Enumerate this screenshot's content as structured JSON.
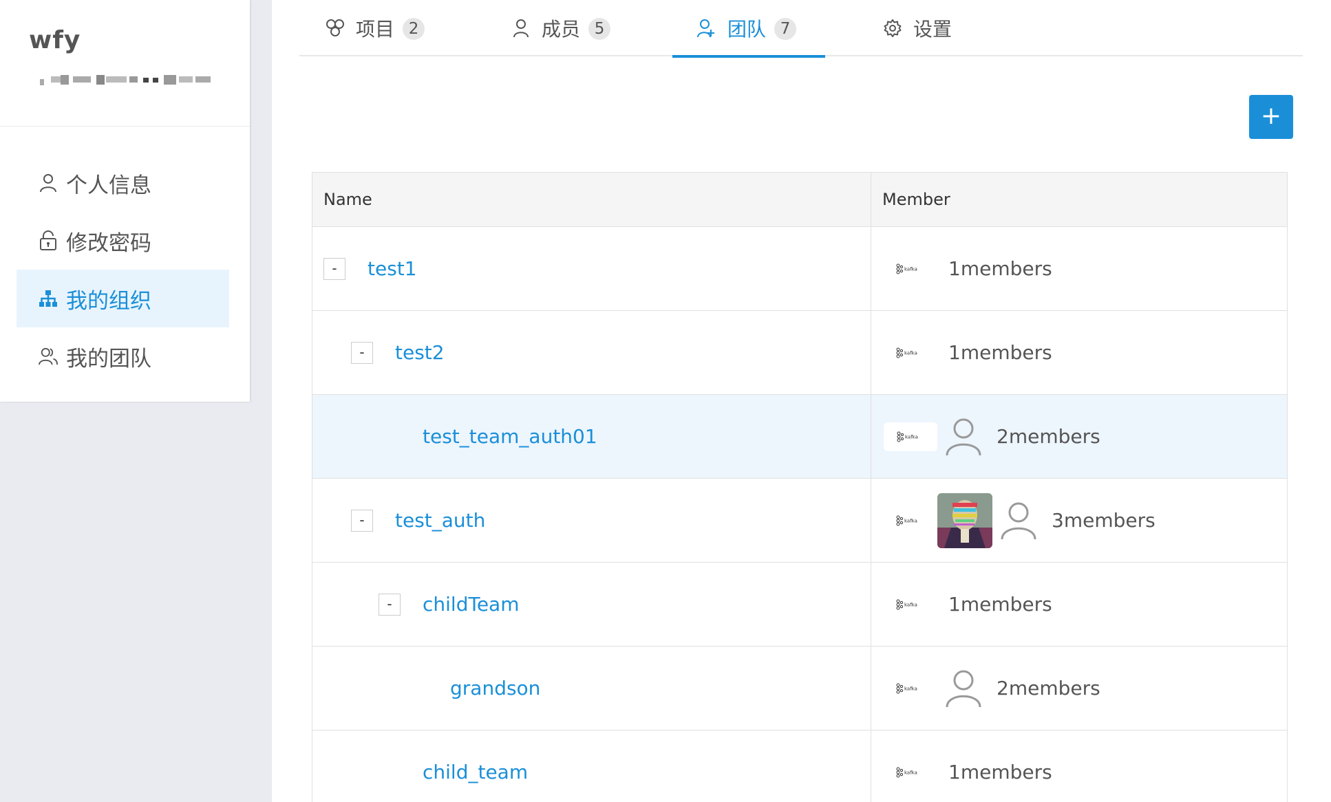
{
  "user": {
    "name": "wfy"
  },
  "sidebar": {
    "items": [
      {
        "label": "个人信息",
        "icon": "user-icon"
      },
      {
        "label": "修改密码",
        "icon": "lock-icon"
      },
      {
        "label": "我的组织",
        "icon": "org-icon",
        "active": true
      },
      {
        "label": "我的团队",
        "icon": "team-icon"
      }
    ]
  },
  "tabs": [
    {
      "label": "项目",
      "count": "2",
      "icon": "project-icon"
    },
    {
      "label": "成员",
      "count": "5",
      "icon": "user-icon"
    },
    {
      "label": "团队",
      "count": "7",
      "icon": "team-icon",
      "active": true
    },
    {
      "label": "设置",
      "icon": "gear-icon"
    }
  ],
  "add_button": {
    "label": "+"
  },
  "table": {
    "headers": {
      "name": "Name",
      "member": "Member"
    },
    "rows": [
      {
        "name": "test1",
        "members": "1members",
        "toggle": "-"
      },
      {
        "name": "test2",
        "members": "1members",
        "toggle": "-"
      },
      {
        "name": "test_team_auth01",
        "members": "2members"
      },
      {
        "name": "test_auth",
        "members": "3members",
        "toggle": "-"
      },
      {
        "name": "childTeam",
        "members": "1members",
        "toggle": "-"
      },
      {
        "name": "grandson",
        "members": "2members"
      },
      {
        "name": "child_team",
        "members": "1members"
      }
    ]
  },
  "colors": {
    "accent": "#1a8fd8",
    "highlight_row": "#edf5fd",
    "sidebar_active_bg": "#e8f4fd"
  }
}
